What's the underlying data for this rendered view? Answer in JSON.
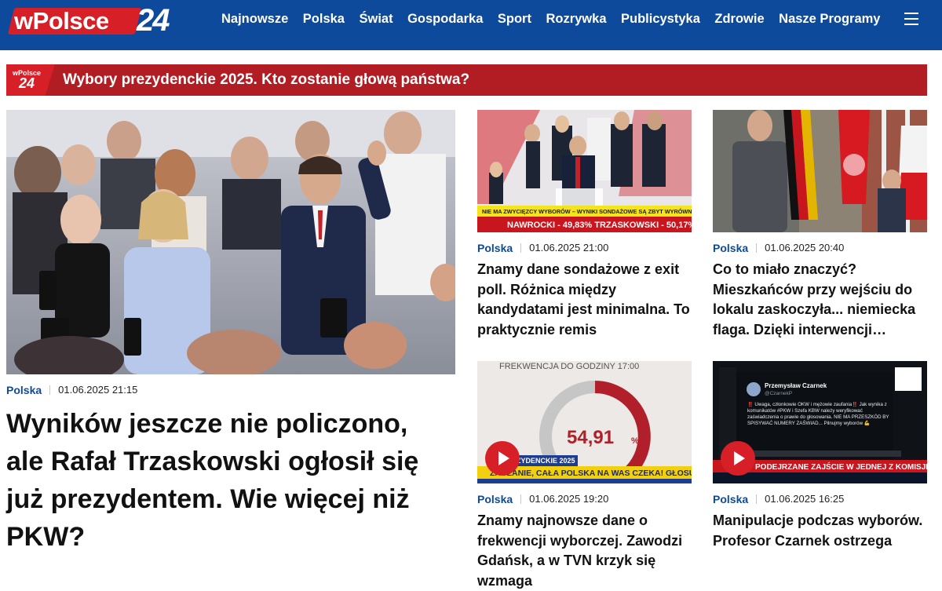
{
  "header": {
    "logo_text": "wPolsce",
    "logo_number": "24",
    "nav": [
      "Najnowsze",
      "Polska",
      "Świat",
      "Gospodarka",
      "Sport",
      "Rozrywka",
      "Publicystyka",
      "Zdrowie",
      "Nasze Programy"
    ]
  },
  "banner": {
    "badge_top": "wPolsce",
    "badge_number": "24",
    "text": "Wybory prezydenckie 2025. Kto zostanie głową państwa?"
  },
  "main_article": {
    "category": "Polska",
    "date": "01.06.2025 21:15",
    "title": "Wyników jeszcze nie policzono, ale Rafał Trzaskowski ogłosił się już prezydentem. Wie więcej niż PKW?"
  },
  "cards": [
    {
      "category": "Polska",
      "date": "01.06.2025 21:00",
      "title": "Znamy dane sondażowe z exit poll. Różnica między kandydatami jest minimalna. To praktycznie remis",
      "image_ticker_1": "NIE MA ZWYCIĘZCY WYBORÓW – WYNIKI SONDAŻOWE SĄ ZBYT WYRÓWNANE",
      "image_ticker_2": "NAWROCKI - 49,83%  TRZASKOWSKI - 50,17%",
      "has_video": false
    },
    {
      "category": "Polska",
      "date": "01.06.2025 20:40",
      "title": "Co to miało znaczyć? Mieszkańców przy wejściu do lokalu zaskoczyła... niemiecka flaga. Dzięki interwencji…",
      "has_video": false
    },
    {
      "category": "Polska",
      "date": "01.06.2025 19:20",
      "title": "Znamy najnowsze dane o frekwencji wyborczej. Zawodzi Gdańsk, a w TVN krzyk się wzmaga",
      "image_heading": "FREKWENCJA DO GODZINY 17:00",
      "image_value": "54,91",
      "image_unit": "%",
      "image_ticker": "ZACZANIE, CAŁA POLSKA NA WAS CZEKA! GŁOSU",
      "image_label": "ZYDENCKIE 2025",
      "has_video": true
    },
    {
      "category": "Polska",
      "date": "01.06.2025 16:25",
      "title": "Manipulacje podczas wyborów. Profesor Czarnek ostrzega",
      "image_author": "Przemysław Czarnek",
      "image_handle": "@CzarnekP",
      "image_post": "‼️ Uwaga, członkowie OKW i mężowie zaufania‼️ Jak wynika z komunikatów #PKW i Szefa KBW należy weryfikować zaświadczenia o prawie do głosowania. NIE MA PRZESZKÓD BY SPISYWAĆ NUMERY ZAŚWIAD... Pilnujmy wyborów 💪",
      "image_ticker": "PODEJRZANE ZAJŚCIE W JEDNEJ Z KOMISJI",
      "has_video": true
    }
  ],
  "colors": {
    "header_bg": "#0d4a9c",
    "brand_red": "#d61f26",
    "banner_red": "#b21d23",
    "category_blue": "#0d4a9c"
  }
}
